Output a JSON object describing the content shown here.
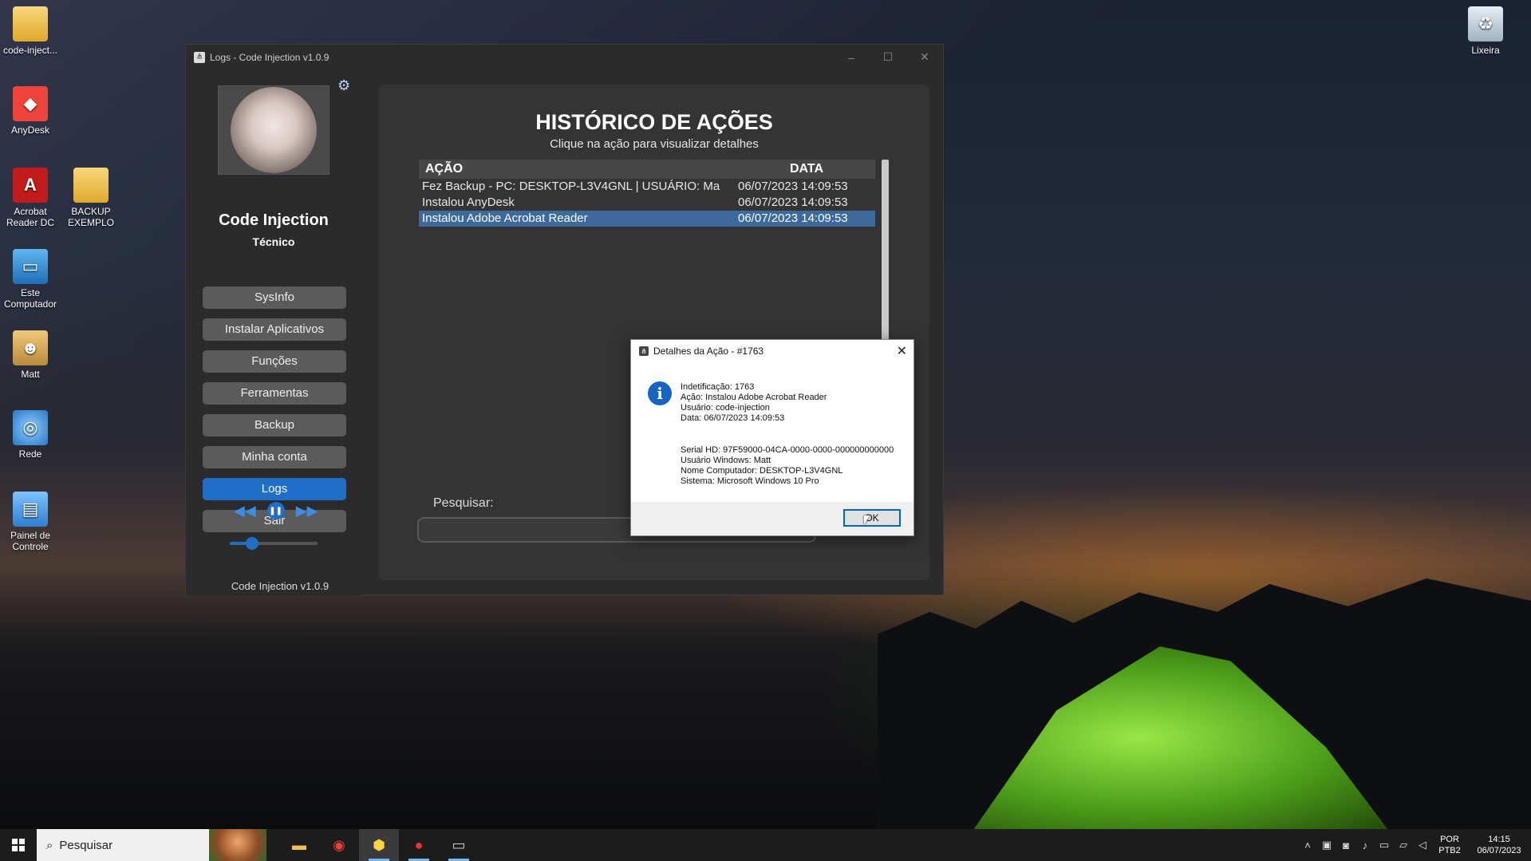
{
  "desktop": {
    "icons_left": [
      {
        "label": "code-inject...",
        "icon": "folder-icon"
      },
      {
        "label": "AnyDesk",
        "icon": "anydesk-icon"
      },
      {
        "label": "Acrobat Reader DC",
        "icon": "acrobat-icon"
      },
      {
        "label": "BACKUP EXEMPLO",
        "icon": "folder-icon"
      },
      {
        "label": "Este Computador",
        "icon": "computer-icon"
      },
      {
        "label": "Matt",
        "icon": "user-folder-icon"
      },
      {
        "label": "Rede",
        "icon": "network-icon"
      },
      {
        "label": "Painel de Controle",
        "icon": "control-panel-icon"
      }
    ],
    "icon_right": {
      "label": "Lixeira",
      "icon": "recycle-bin-icon"
    }
  },
  "app": {
    "title": "Logs - Code Injection v1.0.9",
    "brand": "Code Injection",
    "role": "Técnico",
    "nav": [
      "SysInfo",
      "Instalar Aplicativos",
      "Funções",
      "Ferramentas",
      "Backup",
      "Minha conta",
      "Logs",
      "Sair"
    ],
    "active_nav": "Logs",
    "player_volume": 0.25,
    "version": "Code Injection v1.0.9",
    "heading": "HISTÓRICO DE AÇÕES",
    "subheading": "Clique na ação para visualizar detalhes",
    "table": {
      "headers": [
        "AÇÃO",
        "DATA"
      ],
      "rows": [
        {
          "acao": "Fez Backup - PC: DESKTOP-L3V4GNL | USUÁRIO: Ma",
          "data": "06/07/2023 14:09:53"
        },
        {
          "acao": "Instalou AnyDesk",
          "data": "06/07/2023 14:09:53"
        },
        {
          "acao": "Instalou Adobe Acrobat Reader",
          "data": "06/07/2023 14:09:53"
        }
      ],
      "selected_row": 2
    },
    "search_label": "Pesquisar:",
    "search_value": ""
  },
  "dialog": {
    "title": "Detalhes da Ação - #1763",
    "lines_a": [
      "Indetificação: 1763",
      "Ação: Instalou Adobe Acrobat Reader",
      "Usuário: code-injection",
      "Data: 06/07/2023 14:09:53"
    ],
    "lines_b": [
      "Serial HD: 97F59000-04CA-0000-0000-000000000000",
      "Usuário Windows: Matt",
      "Nome Computador: DESKTOP-L3V4GNL",
      "Sistema: Microsoft Windows 10 Pro"
    ],
    "ok_label": "OK"
  },
  "taskbar": {
    "search_placeholder": "Pesquisar",
    "lang_top": "POR",
    "lang_bottom": "PTB2",
    "time": "14:15",
    "date": "06/07/2023"
  }
}
